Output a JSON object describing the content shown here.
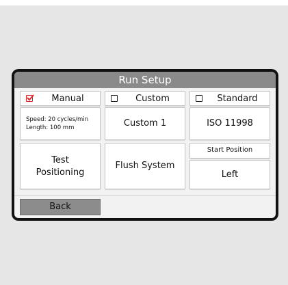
{
  "panel": {
    "title": "Run Setup"
  },
  "modes": {
    "manual": {
      "label": "Manual",
      "checked": true,
      "details": {
        "speed": "Speed: 20 cycles/min",
        "length": "Length: 100 mm"
      }
    },
    "custom": {
      "label": "Custom",
      "checked": false,
      "value": "Custom 1"
    },
    "standard": {
      "label": "Standard",
      "checked": false,
      "value": "ISO 11998"
    }
  },
  "actions": {
    "test_positioning": "Test Positioning",
    "flush_system": "Flush System"
  },
  "start_position": {
    "label": "Start Position",
    "value": "Left"
  },
  "footer": {
    "back_label": "Back"
  },
  "colors": {
    "title_bar": "#8a8a8a",
    "checked_mark": "#e0282c",
    "back_button": "#8c8c8c"
  }
}
